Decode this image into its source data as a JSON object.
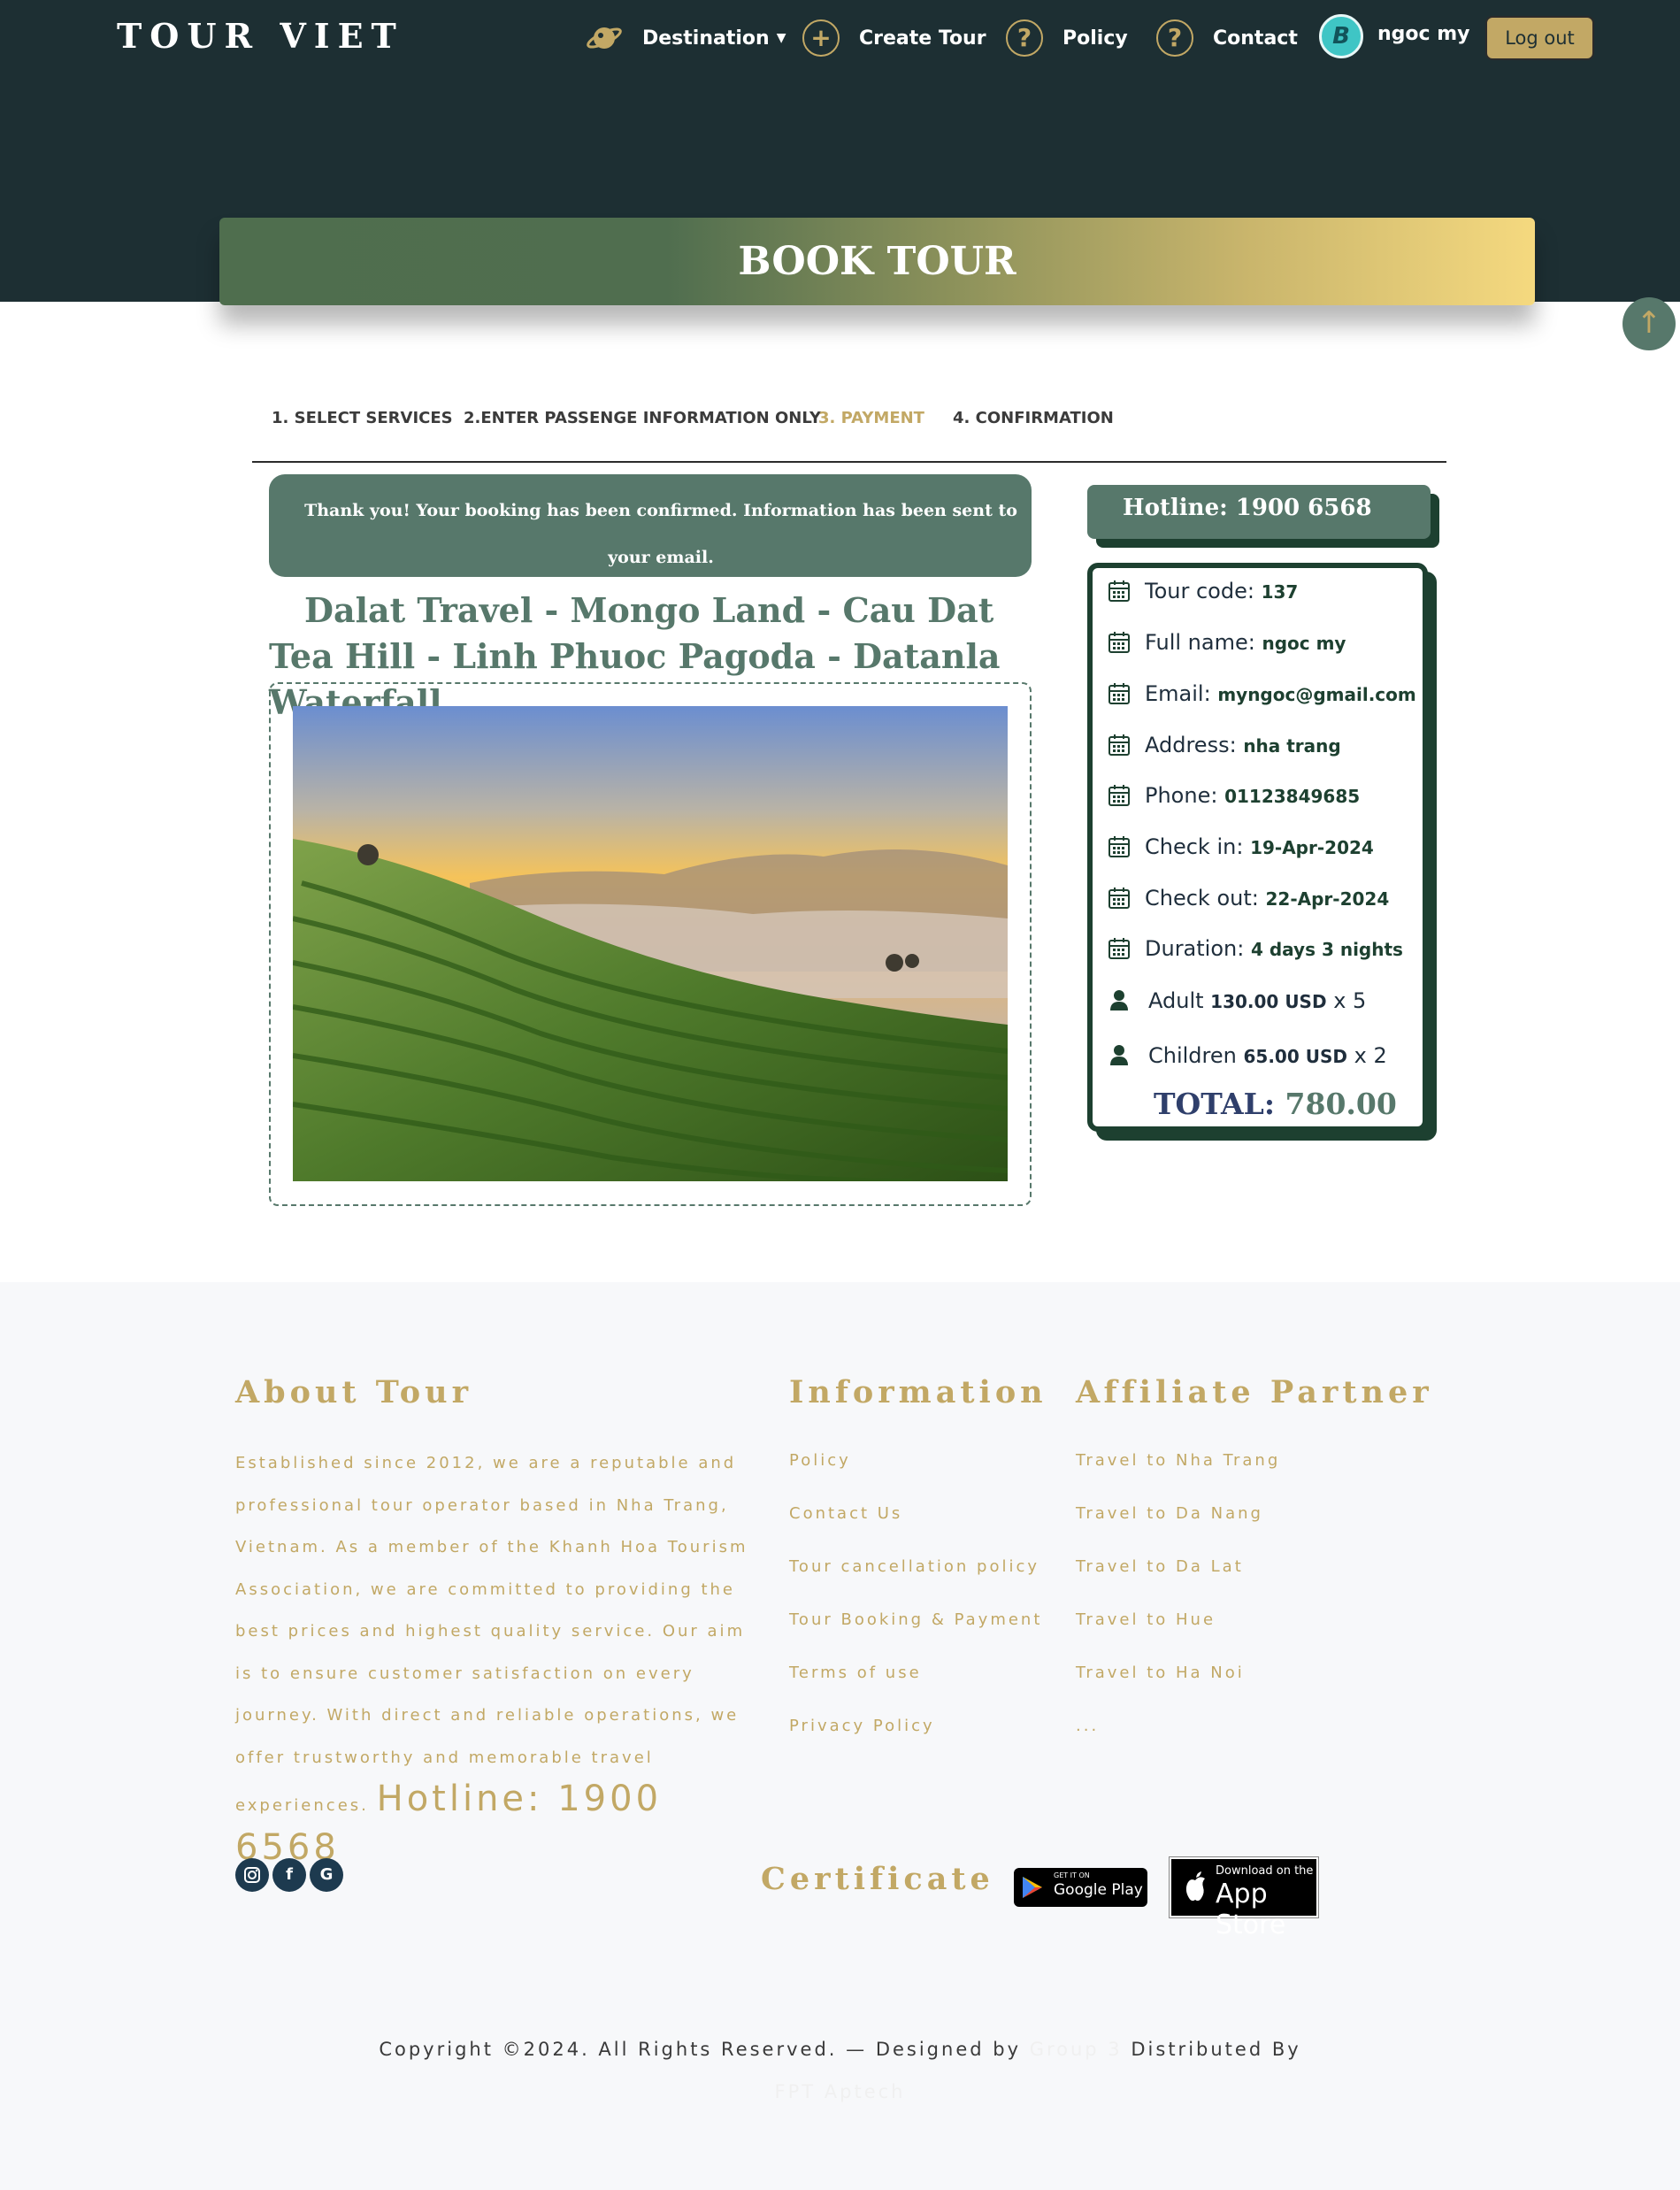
{
  "header": {
    "logo": "TOUR VIET",
    "nav": {
      "destination": "Destination",
      "create_tour": "Create Tour",
      "policy": "Policy",
      "contact": "Contact"
    },
    "user_name": "ngoc my",
    "logout": "Log out"
  },
  "banner": {
    "title": "BOOK TOUR"
  },
  "steps": [
    "1. SELECT SERVICES",
    "2.ENTER PASSENGE INFORMATION ONLY",
    "3. PAYMENT",
    "4. CONFIRMATION"
  ],
  "active_step": "3. PAYMENT",
  "confirmation": {
    "message": "Thank you! Your booking has been confirmed. Information has been sent to your email."
  },
  "tour": {
    "title": "Dalat Travel - Mongo Land - Cau Dat Tea Hill - Linh Phuoc Pagoda - Datanla Waterfall"
  },
  "hotline_box": "Hotline: 1900 6568",
  "booking": {
    "tour_code_label": "Tour code:",
    "tour_code": "137",
    "full_name_label": "Full name:",
    "full_name": "ngoc my",
    "email_label": "Email:",
    "email": "myngoc@gmail.com",
    "address_label": "Address:",
    "address": "nha trang",
    "phone_label": "Phone:",
    "phone": "01123849685",
    "check_in_label": "Check in:",
    "check_in": "19-Apr-2024",
    "check_out_label": "Check out:",
    "check_out": "22-Apr-2024",
    "duration_label": "Duration:",
    "duration": "4 days 3 nights",
    "adult_label": "Adult",
    "adult_price": "130.00 USD",
    "adult_qty": "x 5",
    "children_label": "Children",
    "children_price": "65.00 USD",
    "children_qty": "x 2",
    "total_label": "TOTAL:",
    "total": "780.00"
  },
  "footer": {
    "about_title": "About Tour",
    "about_text": "Established since 2012, we are a reputable and professional tour operator based in Nha Trang, Vietnam. As a member of the Khanh Hoa Tourism Association, we are committed to providing the best prices and highest quality service. Our aim is to ensure customer satisfaction on every journey. With direct and reliable operations, we offer trustworthy and memorable travel experiences.",
    "about_hotline": "Hotline: 1900 6568",
    "info_title": "Information",
    "info_links": [
      "Policy",
      "Contact Us",
      "Tour cancellation policy",
      "Tour Booking & Payment",
      "Terms of use",
      "Privacy Policy"
    ],
    "partner_title": "Affiliate Partner",
    "partner_links": [
      "Travel to Nha Trang",
      "Travel to Da Nang",
      "Travel to Da Lat",
      "Travel to Hue",
      "Travel to Ha Noi",
      "..."
    ],
    "certificate_title": "Certificate",
    "google_play_small": "GET IT ON",
    "google_play_big": "Google Play",
    "app_store_small": "Download on the",
    "app_store_big": "App Store",
    "copyright": "Copyright ©2024. All Rights Reserved. — Designed by",
    "designer": "Group 3",
    "distributed": "Distributed By",
    "distributor": "FPT Aptech"
  },
  "colors": {
    "dark": "#1d2f33",
    "gold": "#c2a865",
    "green": "#57786b",
    "deep_green": "#1d4030"
  }
}
